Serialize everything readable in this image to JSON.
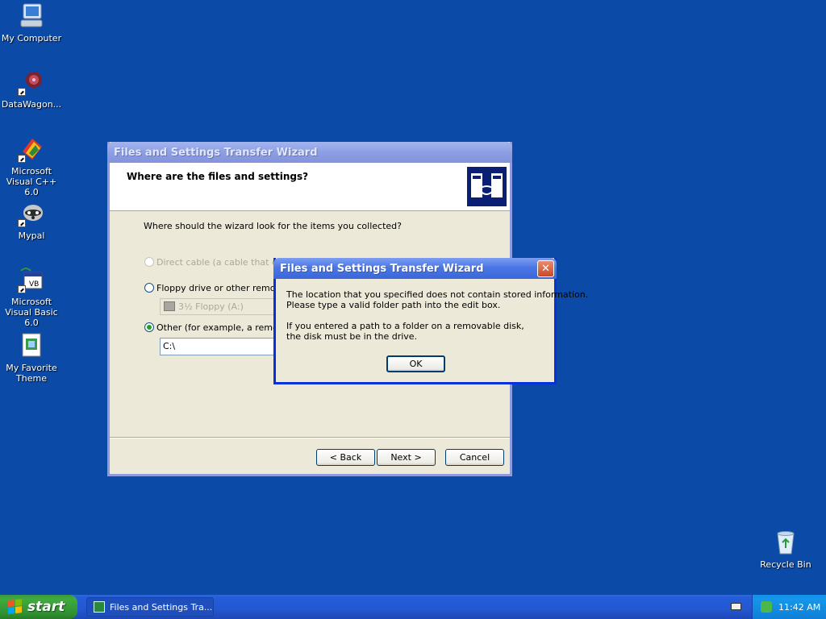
{
  "desktop": {
    "icons": [
      {
        "label": "My Computer"
      },
      {
        "label": "DataWagon..."
      },
      {
        "label": "Microsoft Visual C++ 6.0"
      },
      {
        "label": "Mypal"
      },
      {
        "label": "Microsoft Visual Basic 6.0"
      },
      {
        "label": "My Favorite Theme"
      },
      {
        "label": "Recycle Bin"
      }
    ]
  },
  "wizard": {
    "title": "Files and Settings Transfer Wizard",
    "header": "Where are the files and settings?",
    "question": "Where should the wizard look for the items you collected?",
    "options": [
      {
        "label": "Direct cable (a cable that conn",
        "disabled": true,
        "checked": false
      },
      {
        "label": "Floppy drive or other removable",
        "disabled": false,
        "checked": false
      },
      {
        "label": "Other (for example, a removabl",
        "disabled": false,
        "checked": true
      }
    ],
    "floppy_select": "3½ Floppy (A:)",
    "path_value": "C:\\",
    "buttons": {
      "back": "< Back",
      "next": "Next >",
      "cancel": "Cancel"
    }
  },
  "alert": {
    "title": "Files and Settings Transfer Wizard",
    "line1": "The location that you specified does not contain stored information.",
    "line2": "Please type a valid folder path into the edit box.",
    "line3": "If you entered a path to a folder on a removable disk,",
    "line4": "the disk must be in the drive.",
    "ok": "OK",
    "close_glyph": "✕"
  },
  "taskbar": {
    "start": "start",
    "task_label": "Files and Settings Tra...",
    "clock": "11:42 AM"
  },
  "colors": {
    "desktop": "#0b4aa6",
    "taskbar": "#245edb",
    "start_button": "#3fab3f",
    "tray": "#1496ea"
  }
}
